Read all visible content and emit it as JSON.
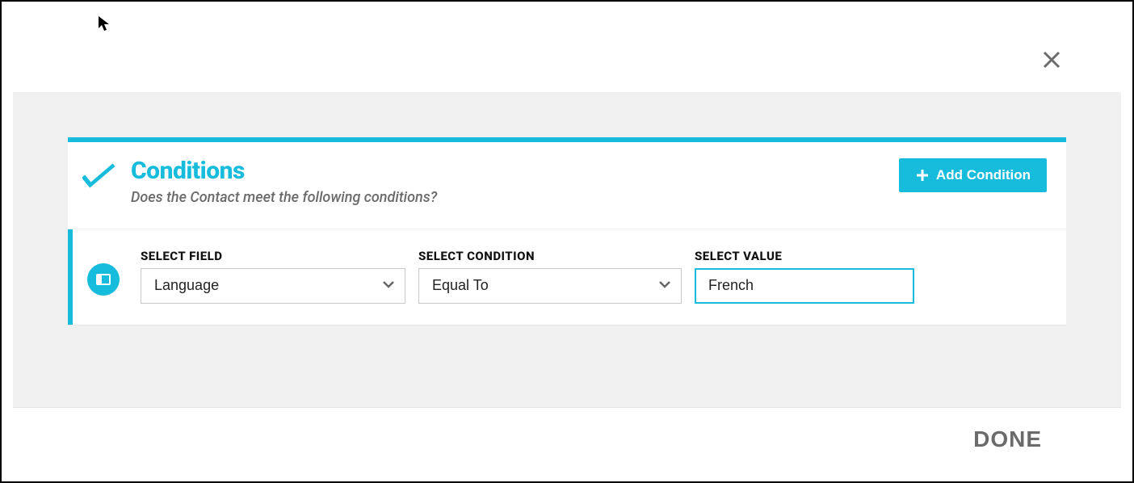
{
  "header": {
    "title": "Conditions",
    "subtitle": "Does the Contact meet the following conditions?"
  },
  "buttons": {
    "add_condition": "Add Condition",
    "done": "DONE"
  },
  "labels": {
    "select_field": "SELECT FIELD",
    "select_condition": "SELECT CONDITION",
    "select_value": "SELECT VALUE"
  },
  "condition": {
    "field": "Language",
    "operator": "Equal To",
    "value": "French"
  },
  "icons": {
    "check": "check-icon",
    "close": "close-icon",
    "plus": "plus-icon",
    "row": "row-icon",
    "chevron": "chevron-down-icon"
  },
  "colors": {
    "accent": "#17bcdc",
    "text_muted": "#6b6b6b",
    "bg_muted": "#f0f0f0",
    "border": "#c9c9c9"
  }
}
